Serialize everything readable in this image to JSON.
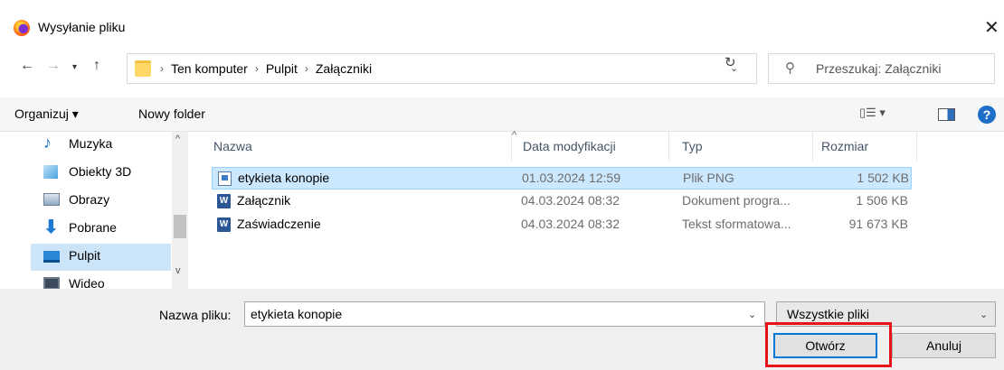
{
  "window": {
    "title": "Wysyłanie pliku"
  },
  "navigation": {
    "breadcrumb": [
      "Ten komputer",
      "Pulpit",
      "Załączniki"
    ],
    "search_placeholder": "Przeszukaj: Załączniki"
  },
  "toolbar": {
    "organize_label": "Organizuj ▾",
    "new_folder_label": "Nowy folder",
    "view_label": "▯☰ ▾"
  },
  "sidebar": {
    "items": [
      {
        "label": "Muzyka",
        "icon": "music-icon"
      },
      {
        "label": "Obiekty 3D",
        "icon": "3d-objects-icon"
      },
      {
        "label": "Obrazy",
        "icon": "pictures-icon"
      },
      {
        "label": "Pobrane",
        "icon": "downloads-icon"
      },
      {
        "label": "Pulpit",
        "icon": "desktop-icon",
        "selected": true
      },
      {
        "label": "Wideo",
        "icon": "video-icon"
      }
    ]
  },
  "file_list": {
    "columns": [
      "Nazwa",
      "Data modyfikacji",
      "Typ",
      "Rozmiar"
    ],
    "rows": [
      {
        "name": "etykieta konopie",
        "date": "01.03.2024 12:59",
        "type": "Plik PNG",
        "size": "1 502 KB",
        "icon": "png-file-icon",
        "selected": true
      },
      {
        "name": "Załącznik",
        "date": "04.03.2024 08:32",
        "type": "Dokument progra...",
        "size": "1 506 KB",
        "icon": "word-file-icon"
      },
      {
        "name": "Zaświadczenie",
        "date": "04.03.2024 08:32",
        "type": "Tekst sformatowa...",
        "size": "91 673 KB",
        "icon": "word-file-icon"
      }
    ]
  },
  "footer": {
    "filename_label": "Nazwa pliku:",
    "filename_value": "etykieta konopie",
    "filter_value": "Wszystkie pliki",
    "open_label": "Otwórz",
    "cancel_label": "Anuluj"
  },
  "colors": {
    "selection": "#cce8ff",
    "highlight_box": "#e8121b",
    "accent": "#0078d7"
  }
}
